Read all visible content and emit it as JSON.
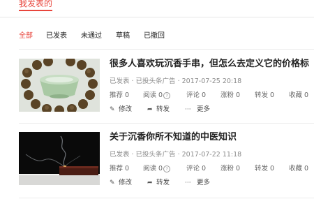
{
  "header": {
    "active_tab": "我发表的"
  },
  "filters": [
    {
      "label": "全部",
      "active": true
    },
    {
      "label": "已发表",
      "active": false
    },
    {
      "label": "未通过",
      "active": false
    },
    {
      "label": "草稿",
      "active": false
    },
    {
      "label": "已撤回",
      "active": false
    }
  ],
  "articles": [
    {
      "title": "很多人喜欢玩沉香手串，但怎么去定义它的价格标",
      "meta": "已发表 · 已投头条广告 · 2017-07-25 20:18",
      "stats": {
        "recommend": "推荐 0",
        "reads": "阅读 0",
        "comments": "评论 0",
        "fans": "涨粉 0",
        "shares": "转发 0",
        "favorites": "收藏 0"
      },
      "actions": {
        "edit": "修改",
        "share": "转发",
        "more": "更多"
      },
      "thumb_icon": "bead-bracelet-image"
    },
    {
      "title": "关于沉香你所不知道的中医知识",
      "meta": "已发表 · 已投头条广告 · 2017-07-22 11:18",
      "stats": {
        "recommend": "推荐 0",
        "reads": "阅读 0",
        "comments": "评论 0",
        "fans": "涨粉 0",
        "shares": "转发 0",
        "favorites": "收藏 0"
      },
      "actions": {
        "edit": "修改",
        "share": "转发",
        "more": "更多"
      },
      "thumb_icon": "incense-smoke-image"
    }
  ],
  "icons": {
    "help": "?",
    "edit": "✎",
    "share": "➦",
    "more": "···"
  },
  "colors": {
    "accent": "#e8453c",
    "meta": "#8a8a8a"
  }
}
